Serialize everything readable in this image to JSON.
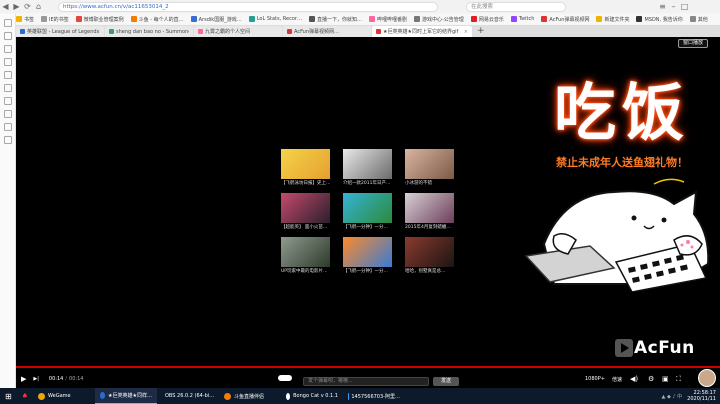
{
  "browser": {
    "url": "https://www.acfun.cn/v/ac11653014_2",
    "search_placeholder": "在此搜索",
    "nav_icons": [
      "◀",
      "▶",
      "⟳",
      "⌂"
    ]
  },
  "bookmarks": [
    {
      "label": "书签",
      "color": "#f0b400"
    },
    {
      "label": "IE的书签",
      "color": "#999"
    },
    {
      "label": "微博职业管理案例",
      "color": "#e2473b"
    },
    {
      "label": "斗鱼 - 每个人的直…",
      "color": "#f57c00"
    },
    {
      "label": "Arsdik国服_游戏…",
      "color": "#3b6bd6"
    },
    {
      "label": "LoL Stats, Recor…",
      "color": "#2a9d8f"
    },
    {
      "label": "直播一下，你就知…",
      "color": "#555"
    },
    {
      "label": "哔哩哔哩番剧",
      "color": "#ff6699"
    },
    {
      "label": "游戏中心-公告管理",
      "color": "#777"
    },
    {
      "label": "网易云音乐",
      "color": "#e02020"
    },
    {
      "label": "Twitch",
      "color": "#9146ff"
    },
    {
      "label": "AcFun弹幕视频网",
      "color": "#d33"
    },
    {
      "label": "新建文件夹",
      "color": "#f0b400"
    },
    {
      "label": "MSDN, 我告诉你",
      "color": "#333"
    },
    {
      "label": "其他",
      "color": "#888"
    }
  ],
  "tabs": [
    {
      "label": "英雄联盟 - League of Legends",
      "color": "#2a6bd1",
      "active": false
    },
    {
      "label": "sheng dan bao no - Summoner S…",
      "color": "#2a9d8f",
      "active": false
    },
    {
      "label": "九霄之霸的个人空间",
      "color": "#ff6699",
      "active": false
    },
    {
      "label": "AcFun弹幕视频网…",
      "color": "#d33",
      "active": false
    },
    {
      "label": "★巨类英雄★同时上军它的结界gif",
      "color": "#d33",
      "active": true
    }
  ],
  "player": {
    "close_button": "窗口播放",
    "thumbs": [
      {
        "caption": "【飞鹤泳坊日报】史上…",
        "colors": [
          "#f6d34a",
          "#e4a02f"
        ]
      },
      {
        "caption": "介绍一款2011年日产…",
        "colors": [
          "#e9e9e9",
          "#6b6b6b"
        ]
      },
      {
        "caption": "小冰游的不错",
        "colors": [
          "#d9b4a0",
          "#7b5a48"
        ]
      },
      {
        "caption": "【超能英】 面小火苗…",
        "colors": [
          "#c64a6b",
          "#2a1f2d"
        ]
      },
      {
        "caption": "【飞鹤一分钟】一分…",
        "colors": [
          "#36b3d8",
          "#2b8a3a"
        ]
      },
      {
        "caption": "2015年4月复刻蜡蠟…",
        "colors": [
          "#d9d0d6",
          "#6b3f59"
        ]
      },
      {
        "caption": "UP玩家中最的电影片…",
        "colors": [
          "#909a8f",
          "#2d3b2b"
        ]
      },
      {
        "caption": "【飞鹤一分钟】一分…",
        "colors": [
          "#fd8a2a",
          "#3a7bd5"
        ]
      },
      {
        "caption": "哈哈，别墅真是总…",
        "colors": [
          "#8a3b2f",
          "#1c1512"
        ]
      }
    ],
    "overlay": {
      "title": "吃饭",
      "banner": "禁止未成年人送鱼翅礼物！"
    },
    "logo_text": "AcFun",
    "controls": {
      "time_current": "00:14",
      "time_total": "00:14",
      "danmu_placeholder": "发个弹幕呗，嗷嗷...",
      "send": "发送",
      "quality": "1080P+",
      "speed": "倍速",
      "play_icon": "▶",
      "next_icon": "▶|"
    }
  },
  "taskbar": [
    {
      "label": "WeGame",
      "color": "#f0a600",
      "active": false
    },
    {
      "label": "★巨类英雄★同样…",
      "color": "#2a6bd1",
      "active": true
    },
    {
      "label": "OBS 26.0.2 (64-bi…",
      "color": "#eee",
      "active": false
    },
    {
      "label": "斗鱼直播伴侣",
      "color": "#f57c00",
      "active": false
    },
    {
      "label": "Bongo Cat v 0.1.1",
      "color": "#fff",
      "active": false
    },
    {
      "label": "1457566703-阿里…",
      "color": "#3aa0ff",
      "active": false
    }
  ],
  "clock": {
    "time": "22:58:17",
    "date": "2020/11/11"
  }
}
